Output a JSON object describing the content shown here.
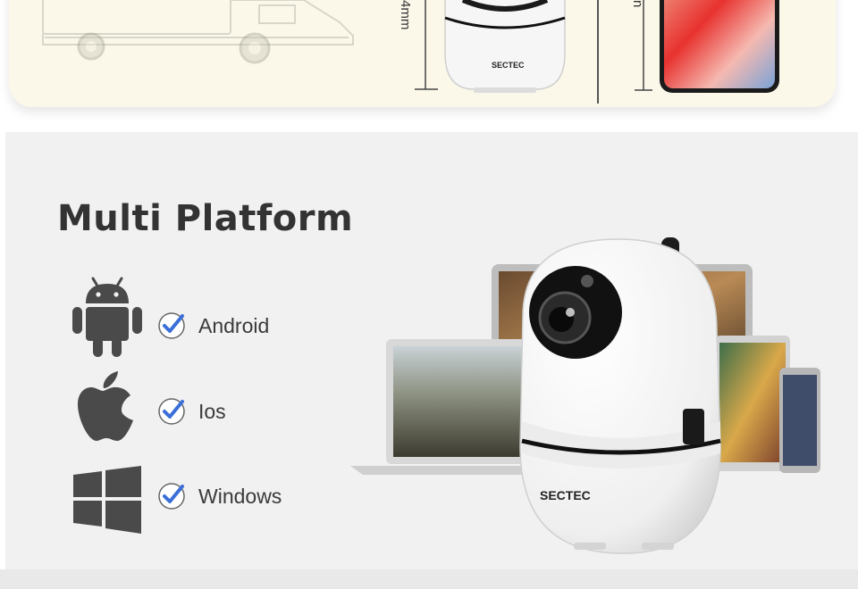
{
  "top": {
    "dimension_label_1": "4mm",
    "dimension_label_2": "n",
    "brand_small": "SECTEC"
  },
  "section": {
    "title": "Multi Platform",
    "platforms": [
      {
        "label": "Android",
        "icon": "android-icon"
      },
      {
        "label": "Ios",
        "icon": "apple-icon"
      },
      {
        "label": "Windows",
        "icon": "windows-icon"
      }
    ]
  },
  "camera": {
    "brand": "SECTEC"
  },
  "colors": {
    "panel_bg": "#f1f1f1",
    "top_card_bg": "#fbf8ea",
    "icon_gray": "#4a4a4a",
    "check_blue": "#3b6fd8",
    "title_text": "#333333"
  }
}
